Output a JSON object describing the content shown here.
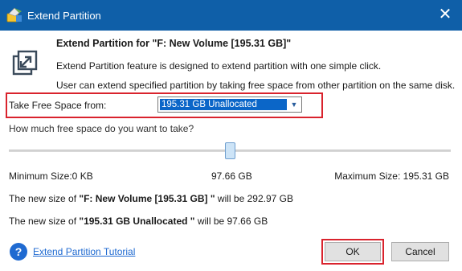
{
  "window": {
    "title": "Extend Partition"
  },
  "dialog": {
    "heading": "Extend Partition for \"F: New Volume [195.31 GB]\"",
    "description_line1": "Extend Partition feature is designed to extend partition with one simple click.",
    "description_line2": "User can extend specified partition by taking free space from other partition on the same disk."
  },
  "take_free_space": {
    "label": "Take Free Space from:",
    "selected": "195.31 GB Unallocated"
  },
  "question": "How much free space do you want to take?",
  "slider": {
    "min_label": "Minimum Size:0 KB",
    "current_label": "97.66 GB",
    "max_label": "Maximum Size: 195.31 GB",
    "position_fraction": 0.5
  },
  "new_size": {
    "line1_prefix": "The new size of ",
    "line1_name": "\"F: New Volume [195.31 GB] \"",
    "line1_suffix": " will be 292.97 GB",
    "line2_prefix": "The new size of ",
    "line2_name": "\"195.31 GB Unallocated \"",
    "line2_suffix": " will be 97.66 GB"
  },
  "footer": {
    "tutorial_link": "Extend Partition Tutorial",
    "ok_label": "OK",
    "cancel_label": "Cancel"
  },
  "colors": {
    "titlebar": "#0f5fa8",
    "highlight_outline": "#d9232d",
    "selection": "#0b66c8",
    "link": "#1f6ad1"
  },
  "icons": {
    "app": "partition-wizard-icon",
    "close": "close-icon",
    "dialog": "extend-partition-icon",
    "dropdown": "chevron-down-icon",
    "help": "help-icon"
  }
}
